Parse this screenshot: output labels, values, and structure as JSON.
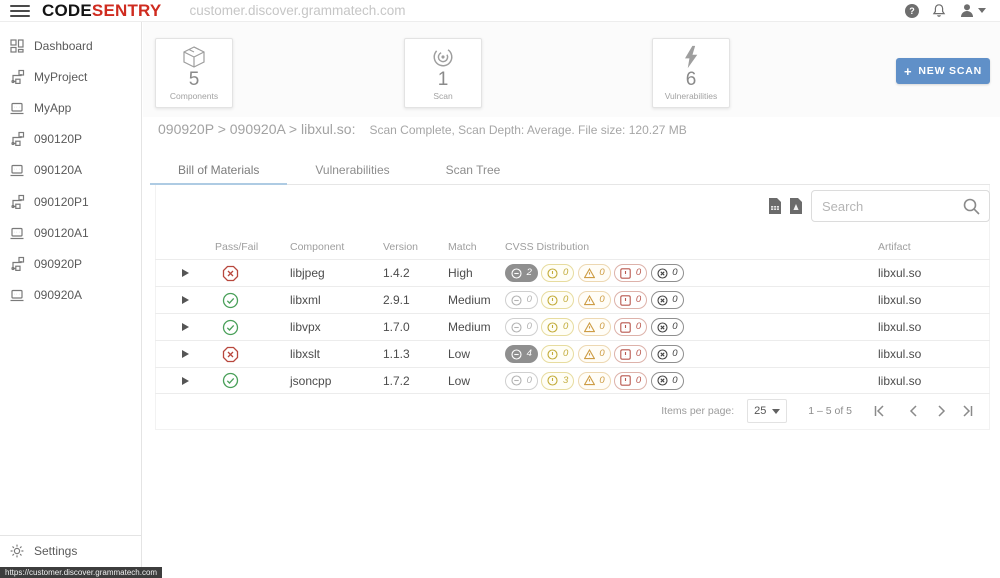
{
  "header": {
    "logo_code": "CODE",
    "logo_sentry": "SENTRY",
    "url": "customer.discover.grammatech.com",
    "help_glyph": "?",
    "icons": [
      "help-icon",
      "notifications-bell-icon",
      "user-account-icon"
    ]
  },
  "sidebar": {
    "items": [
      {
        "label": "Dashboard",
        "icon": "dashboard-icon"
      },
      {
        "label": "MyProject",
        "icon": "project-icon"
      },
      {
        "label": "MyApp",
        "icon": "app-icon"
      },
      {
        "label": "090120P",
        "icon": "project-icon"
      },
      {
        "label": "090120A",
        "icon": "app-icon"
      },
      {
        "label": "090120P1",
        "icon": "project-icon"
      },
      {
        "label": "090120A1",
        "icon": "app-icon"
      },
      {
        "label": "090920P",
        "icon": "project-icon"
      },
      {
        "label": "090920A",
        "icon": "app-icon"
      }
    ],
    "settings_label": "Settings",
    "status_url": "https://customer.discover.grammatech.com"
  },
  "summary_cards": [
    {
      "icon": "components-icon",
      "value": "5",
      "label": "Components"
    },
    {
      "icon": "scan-icon",
      "value": "1",
      "label": "Scan"
    },
    {
      "icon": "vulnerabilities-icon",
      "value": "6",
      "label": "Vulnerabilities"
    }
  ],
  "new_scan": {
    "plus": "+",
    "label": "NEW SCAN"
  },
  "breadcrumb": {
    "path": "090920P > 090920A > libxul.so:",
    "status": "Scan Complete, Scan Depth: Average. File size: 120.27 MB"
  },
  "tabs": [
    {
      "label": "Bill of Materials",
      "active": true
    },
    {
      "label": "Vulnerabilities",
      "active": false
    },
    {
      "label": "Scan Tree",
      "active": false
    }
  ],
  "toolbar": {
    "search_placeholder": "Search",
    "export_icons": [
      "export-report-icon",
      "export-pdf-icon"
    ]
  },
  "table": {
    "columns": [
      "Pass/Fail",
      "Component",
      "Version",
      "Match",
      "CVSS Distribution",
      "Artifact"
    ],
    "cvss_severities": [
      {
        "name": "none",
        "icon": "minus-circle-icon"
      },
      {
        "name": "low",
        "icon": "info-circle-icon"
      },
      {
        "name": "medium",
        "icon": "warning-triangle-icon"
      },
      {
        "name": "high",
        "icon": "alert-square-icon"
      },
      {
        "name": "critical",
        "icon": "x-circle-icon"
      }
    ],
    "rows": [
      {
        "pass": false,
        "component": "libjpeg",
        "version": "1.4.2",
        "match": "High",
        "cvss": [
          2,
          0,
          0,
          0,
          0
        ],
        "artifact": "libxul.so"
      },
      {
        "pass": true,
        "component": "libxml",
        "version": "2.9.1",
        "match": "Medium",
        "cvss": [
          0,
          0,
          0,
          0,
          0
        ],
        "artifact": "libxul.so"
      },
      {
        "pass": true,
        "component": "libvpx",
        "version": "1.7.0",
        "match": "Medium",
        "cvss": [
          0,
          0,
          0,
          0,
          0
        ],
        "artifact": "libxul.so"
      },
      {
        "pass": false,
        "component": "libxslt",
        "version": "1.1.3",
        "match": "Low",
        "cvss": [
          4,
          0,
          0,
          0,
          0
        ],
        "artifact": "libxul.so"
      },
      {
        "pass": true,
        "component": "jsoncpp",
        "version": "1.7.2",
        "match": "Low",
        "cvss": [
          0,
          3,
          0,
          0,
          0
        ],
        "artifact": "libxul.so"
      }
    ]
  },
  "pagination": {
    "items_per_page_label": "Items per page:",
    "items_per_page_value": "25",
    "range_label": "1 – 5 of 5"
  },
  "colors": {
    "accent_blue": "#6090c8",
    "logo_red": "#cf2b1f",
    "tab_underline": "#aecbe3",
    "pass_green": "#4aa05a",
    "fail_red": "#b8473d",
    "badge_gray": "#8f8f8f",
    "badge_yellow": "#c2ab38",
    "badge_orange": "#cd9c44",
    "badge_red": "#b9574e"
  }
}
